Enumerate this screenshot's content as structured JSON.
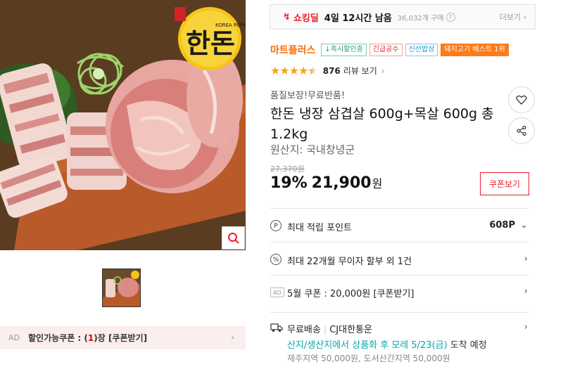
{
  "image_panel": {
    "logo_text": "한돈",
    "logo_sub": "KOREA PORK",
    "zoom_icon": "search-icon"
  },
  "coupon_bar": {
    "ad": "AD",
    "text_before": "할인가능쿠폰 : (",
    "count": "1",
    "text_after": ")장 [쿠폰받기]"
  },
  "deal": {
    "label": "쇼킹딜",
    "time_left": "4일 12시간 남음",
    "sold": "36,032개 구매",
    "more": "더보기"
  },
  "shop": {
    "name": "마트플러스",
    "badges": [
      "↓즉시할인중",
      "긴급공수",
      "신선밥상",
      "돼지고기 베스트 1위"
    ]
  },
  "rating": {
    "stars": 4.5,
    "review_count": "876",
    "review_label": "리뷰 보기"
  },
  "product": {
    "promo": "품질보장!무료반품!",
    "title": "한돈 냉장 삼겹살 600g+목살 600g 총 1.2kg",
    "origin": "원산지: 국내창녕군"
  },
  "price": {
    "original": "27,370원",
    "discount": "19%",
    "current": "21,900",
    "unit": "원",
    "coupon_button": "쿠폰보기"
  },
  "benefits": {
    "points_label": "최대 적립 포인트",
    "points_value": "608P",
    "installment": "최대 22개월 무이자 할부 외 1건",
    "coupon_ad": "AD",
    "coupon": "5월 쿠폰 : 20,000원 [쿠폰받기]"
  },
  "shipping": {
    "fee": "무료배송",
    "carrier": "CJ대한통운",
    "schedule_highlight": "산지/생산지에서 상품화 후 모레 5/23(금)",
    "schedule_rest": "도착 예정",
    "extra": "제주지역 50,000원, 도서산간지역 50,000원"
  },
  "colors": {
    "accent_red": "#e8202a",
    "shop_orange": "#ff6a00",
    "star": "#f4a51c",
    "teal": "#0ea4a4"
  }
}
